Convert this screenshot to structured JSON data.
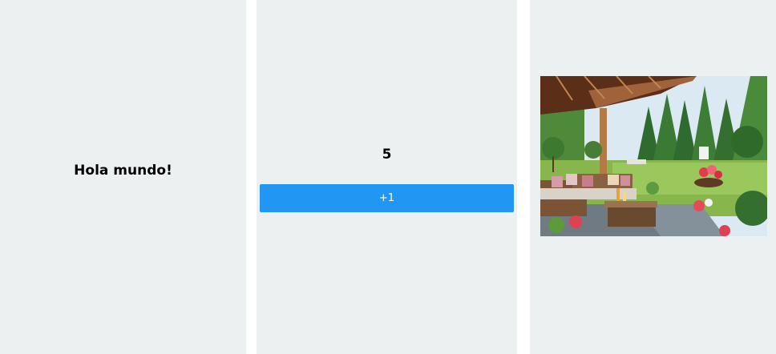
{
  "panels": {
    "greeting": {
      "text": "Hola mundo!"
    },
    "counter": {
      "value": "5",
      "button_label": "+1"
    },
    "image": {
      "subject": "garden patio with wicker furniture"
    }
  }
}
